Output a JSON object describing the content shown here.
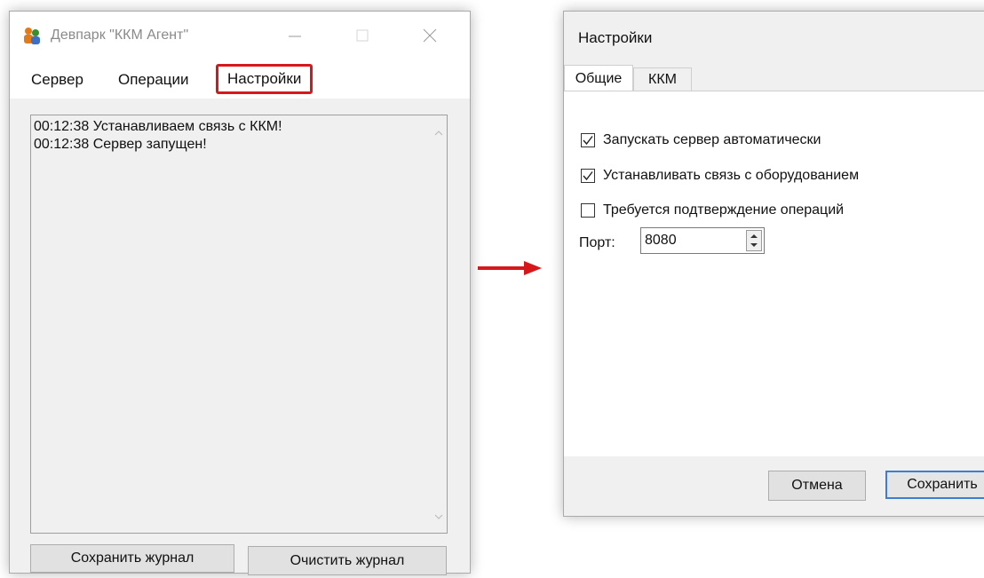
{
  "main_window": {
    "title": "Девпарк \"ККМ Агент\"",
    "icon": "users-icon",
    "menu": [
      "Сервер",
      "Операции",
      "Настройки"
    ],
    "highlighted_menu": "Настройки",
    "highlight_color": "#d8171a",
    "log_lines": [
      "00:12:38 Устанавливаем связь с ККМ!",
      "00:12:38 Сервер запущен!"
    ],
    "buttons": {
      "save_log": "Сохранить журнал",
      "clear_log": "Очистить журнал"
    }
  },
  "arrow": {
    "icon": "arrow-right-icon",
    "color": "#d8171a"
  },
  "settings_window": {
    "title": "Настройки",
    "tabs": [
      "Общие",
      "ККМ"
    ],
    "active_tab": "Общие",
    "checkboxes": [
      {
        "label": "Запускать сервер автоматически",
        "checked": true
      },
      {
        "label": "Устанавливать связь с оборудованием",
        "checked": true
      },
      {
        "label": "Требуется подтверждение операций",
        "checked": false
      }
    ],
    "port": {
      "label": "Порт:",
      "value": "8080"
    },
    "buttons": {
      "cancel": "Отмена",
      "save": "Сохранить"
    },
    "accent": "#3c7fd1"
  }
}
